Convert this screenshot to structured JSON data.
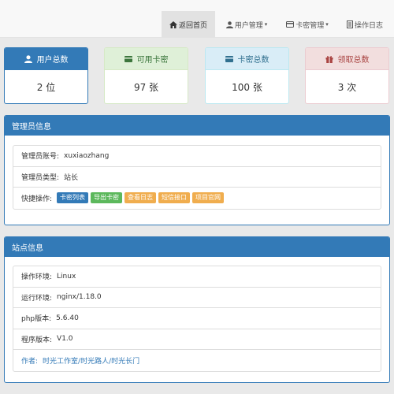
{
  "nav": {
    "home": "返回首页",
    "users": "用户管理",
    "cards": "卡密管理",
    "logs": "操作日志"
  },
  "stats": [
    {
      "label": "用户总数",
      "value": "2 位",
      "icon": "user-icon"
    },
    {
      "label": "可用卡密",
      "value": "97 张",
      "icon": "card-icon"
    },
    {
      "label": "卡密总数",
      "value": "100 张",
      "icon": "card-icon"
    },
    {
      "label": "领取总数",
      "value": "3 次",
      "icon": "gift-icon"
    }
  ],
  "admin_panel": {
    "title": "管理员信息",
    "account_label": "管理员账号:",
    "account_value": "xuxiaozhang",
    "type_label": "管理员类型:",
    "type_value": "站长",
    "quick_label": "快捷操作:",
    "quick_actions": [
      "卡密列表",
      "导出卡密",
      "查看日志",
      "短信接口",
      "项目官网"
    ]
  },
  "site_panel": {
    "title": "站点信息",
    "rows": [
      {
        "label": "操作环境:",
        "value": "Linux"
      },
      {
        "label": "运行环境:",
        "value": "nginx/1.18.0"
      },
      {
        "label": "php版本:",
        "value": "5.6.40"
      },
      {
        "label": "程序版本:",
        "value": "V1.0"
      }
    ],
    "author_label": "作者:",
    "author_value": "时光工作室/时光路人/时光长门"
  },
  "colors": {
    "primary": "#337ab7",
    "success": "#5cb85c",
    "warning": "#f0ad4e",
    "success_bg": "#dff0d8",
    "info_bg": "#d9edf7",
    "danger_bg": "#f2dede"
  }
}
